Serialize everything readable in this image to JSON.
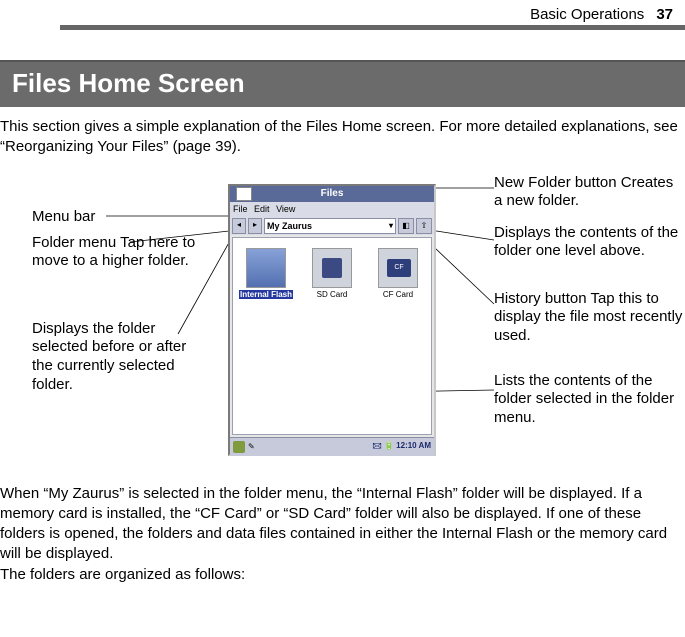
{
  "header": {
    "section": "Basic Operations",
    "page": "37"
  },
  "title": "Files Home Screen",
  "intro": "This section gives a simple explanation of the Files Home screen. For more detailed explanations, see “Reorganizing Your Files” (page 39).",
  "callouts": {
    "left": {
      "menubar": "Menu bar",
      "foldermenu_head": "Folder menu",
      "foldermenu_sub": "Tap here to move to a higher folder.",
      "prevnext": "Displays the folder selected before or after the currently selected folder."
    },
    "right": {
      "newfolder_head": "New Folder button",
      "newfolder_sub": "Creates a new folder.",
      "up": "Displays the contents of the folder one level above.",
      "history_head": "History button",
      "history_sub": "Tap this to display the file most recently used.",
      "contents": "Lists the contents of the folder selected in the folder menu."
    }
  },
  "screenshot": {
    "app_title": "Files",
    "menubar": {
      "file": "File",
      "edit": "Edit",
      "view": "View"
    },
    "folder_dropdown": "My Zaurus",
    "thumbs": {
      "internal": "Internal Flash",
      "sd": "SD Card",
      "cf": "CF Card"
    },
    "clock": "12:10 AM"
  },
  "body_p1": "When “My Zaurus” is selected in the folder menu, the “Internal Flash” folder will be displayed. If a memory card is installed, the “CF Card” or “SD Card” folder will also be displayed. If one of these folders is opened, the folders and data files contained in either the Internal Flash or the memory card will be displayed.",
  "body_p2": "The folders are organized as follows:"
}
